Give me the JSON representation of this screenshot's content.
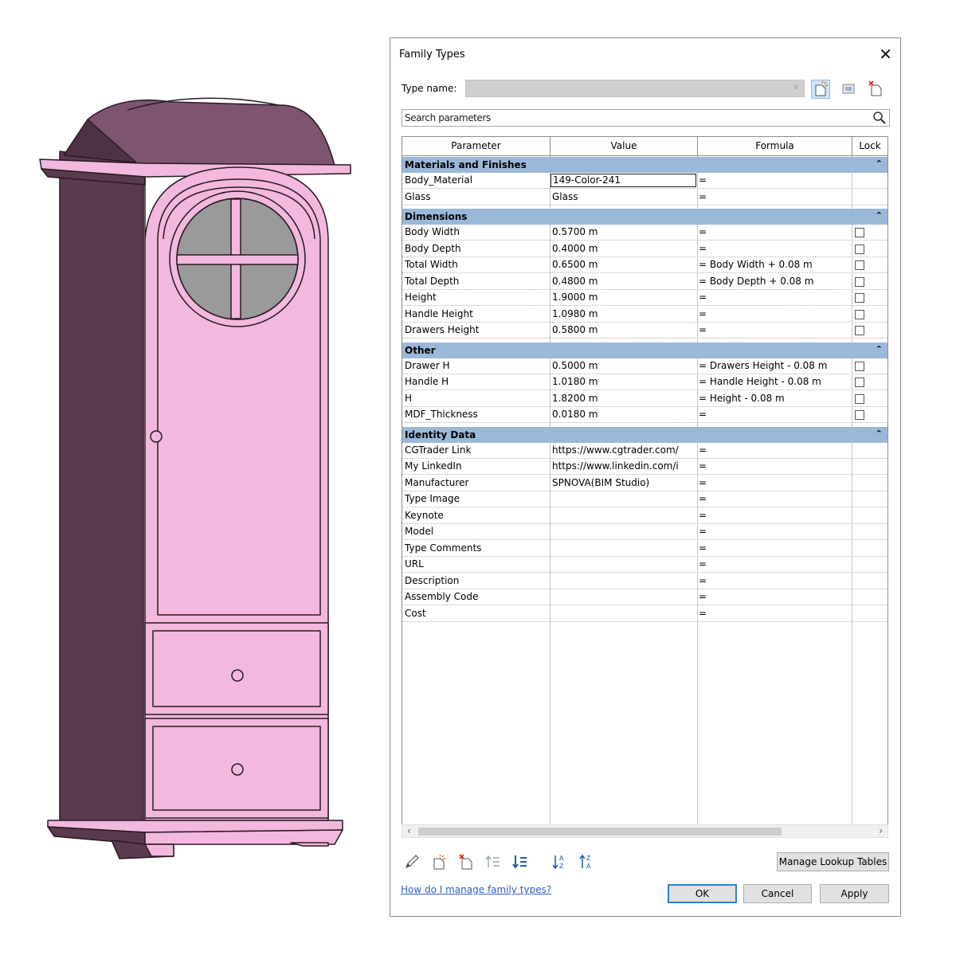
{
  "dialog": {
    "title": "Family Types",
    "close_label": "✕",
    "type_name_label": "Type name:",
    "type_name_value": "",
    "search_placeholder": "Search parameters",
    "columns": {
      "parameter": "Parameter",
      "value": "Value",
      "formula": "Formula",
      "lock": "Lock"
    },
    "groups": [
      {
        "name": "Materials and Finishes",
        "collapse_icon": "⌃",
        "rows": [
          {
            "parameter": "Body_Material",
            "value": "149-Color-241",
            "formula": "=",
            "lock": null,
            "selected": true
          },
          {
            "parameter": "Glass",
            "value": "Glass",
            "formula": "=",
            "lock": null
          }
        ]
      },
      {
        "name": "Dimensions",
        "collapse_icon": "⌃",
        "rows": [
          {
            "parameter": "Body Width",
            "value": "0.5700 m",
            "formula": "=",
            "lock": false
          },
          {
            "parameter": "Body Depth",
            "value": "0.4000 m",
            "formula": "=",
            "lock": false
          },
          {
            "parameter": "Total Width",
            "value": "0.6500 m",
            "formula": "= Body Width + 0.08 m",
            "lock": false
          },
          {
            "parameter": "Total Depth",
            "value": "0.4800 m",
            "formula": "= Body Depth + 0.08 m",
            "lock": false
          },
          {
            "parameter": "Height",
            "value": "1.9000 m",
            "formula": "=",
            "lock": false
          },
          {
            "parameter": "Handle Height",
            "value": "1.0980 m",
            "formula": "=",
            "lock": false
          },
          {
            "parameter": "Drawers Height",
            "value": "0.5800 m",
            "formula": "=",
            "lock": false
          }
        ]
      },
      {
        "name": "Other",
        "collapse_icon": "⌃",
        "rows": [
          {
            "parameter": "Drawer H",
            "value": "0.5000 m",
            "formula": "= Drawers Height - 0.08 m",
            "lock": false
          },
          {
            "parameter": "Handle H",
            "value": "1.0180 m",
            "formula": "= Handle Height - 0.08 m",
            "lock": false
          },
          {
            "parameter": "H",
            "value": "1.8200 m",
            "formula": "= Height - 0.08 m",
            "lock": false
          },
          {
            "parameter": "MDF_Thickness",
            "value": "0.0180 m",
            "formula": "=",
            "lock": false
          }
        ]
      },
      {
        "name": "Identity Data",
        "collapse_icon": "⌃",
        "rows": [
          {
            "parameter": "CGTrader Link",
            "value": "https://www.cgtrader.com/",
            "formula": "=",
            "lock": null
          },
          {
            "parameter": "My LinkedIn",
            "value": "https://www.linkedin.com/i",
            "formula": "=",
            "lock": null
          },
          {
            "parameter": "Manufacturer",
            "value": "SPNOVA(BIM Studio)",
            "formula": "=",
            "lock": null
          },
          {
            "parameter": "Type Image",
            "value": "",
            "formula": "=",
            "lock": null
          },
          {
            "parameter": "Keynote",
            "value": "",
            "formula": "=",
            "lock": null
          },
          {
            "parameter": "Model",
            "value": "",
            "formula": "=",
            "lock": null
          },
          {
            "parameter": "Type Comments",
            "value": "",
            "formula": "=",
            "lock": null
          },
          {
            "parameter": "URL",
            "value": "",
            "formula": "=",
            "lock": null
          },
          {
            "parameter": "Description",
            "value": "",
            "formula": "=",
            "lock": null
          },
          {
            "parameter": "Assembly Code",
            "value": "",
            "formula": "=",
            "lock": null
          },
          {
            "parameter": "Cost",
            "value": "",
            "formula": "=",
            "lock": null
          }
        ]
      }
    ],
    "bottom_icons": [
      "edit-parameter-icon",
      "new-parameter-icon",
      "delete-parameter-icon",
      "move-up-icon",
      "move-down-icon",
      "sort-ascending-icon",
      "sort-descending-icon"
    ],
    "manage_lookup_label": "Manage Lookup Tables",
    "help_link": "How do I manage family types?",
    "ok_label": "OK",
    "cancel_label": "Cancel",
    "apply_label": "Apply",
    "toolbar_icons": [
      "new-type-icon",
      "rename-type-icon",
      "delete-type-icon"
    ],
    "accent_color": "#9cb8d9",
    "link_color": "#2a60c8"
  },
  "viewport": {
    "subject": "cabinet-3d-model",
    "model_color": "#f2b8de",
    "shadow_color": "#5a3a4e"
  }
}
